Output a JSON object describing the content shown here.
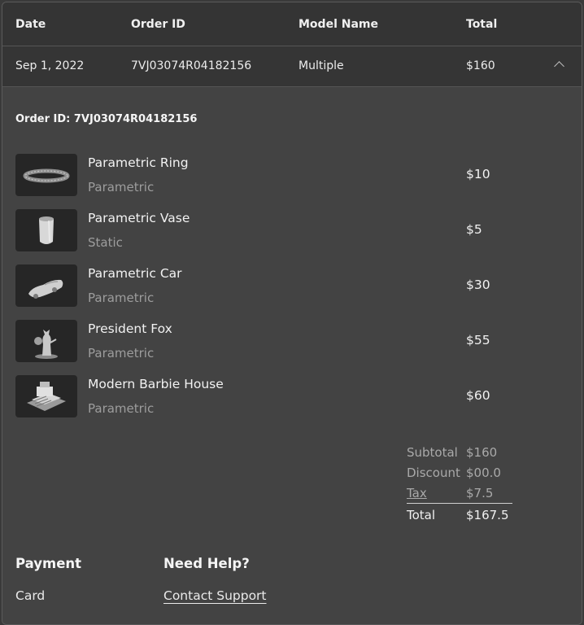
{
  "table": {
    "headers": {
      "date": "Date",
      "order_id": "Order ID",
      "model_name": "Model Name",
      "total": "Total"
    },
    "row": {
      "date": "Sep 1, 2022",
      "order_id": "7VJ03074R04182156",
      "model_name": "Multiple",
      "total": "$160",
      "expanded_icon": "chevron-up-icon"
    }
  },
  "detail": {
    "order_heading": "Order ID: 7VJ03074R04182156",
    "items": [
      {
        "name": "Parametric Ring",
        "type": "Parametric",
        "price": "$10",
        "thumbnail": "ring-model-thumbnail"
      },
      {
        "name": "Parametric Vase",
        "type": "Static",
        "price": "$5",
        "thumbnail": "vase-model-thumbnail"
      },
      {
        "name": "Parametric Car",
        "type": "Parametric",
        "price": "$30",
        "thumbnail": "car-model-thumbnail"
      },
      {
        "name": "President Fox",
        "type": "Parametric",
        "price": "$55",
        "thumbnail": "fox-model-thumbnail"
      },
      {
        "name": "Modern Barbie House",
        "type": "Parametric",
        "price": "$60",
        "thumbnail": "house-model-thumbnail"
      }
    ],
    "summary": {
      "subtotal_label": "Subtotal",
      "subtotal": "$160",
      "discount_label": "Discount",
      "discount": "$00.0",
      "tax_label": "Tax",
      "tax": "$7.5",
      "total_label": "Total",
      "total": "$167.5"
    },
    "payment": {
      "heading": "Payment",
      "method": "Card"
    },
    "help": {
      "heading": "Need Help?",
      "link": "Contact Support"
    }
  }
}
